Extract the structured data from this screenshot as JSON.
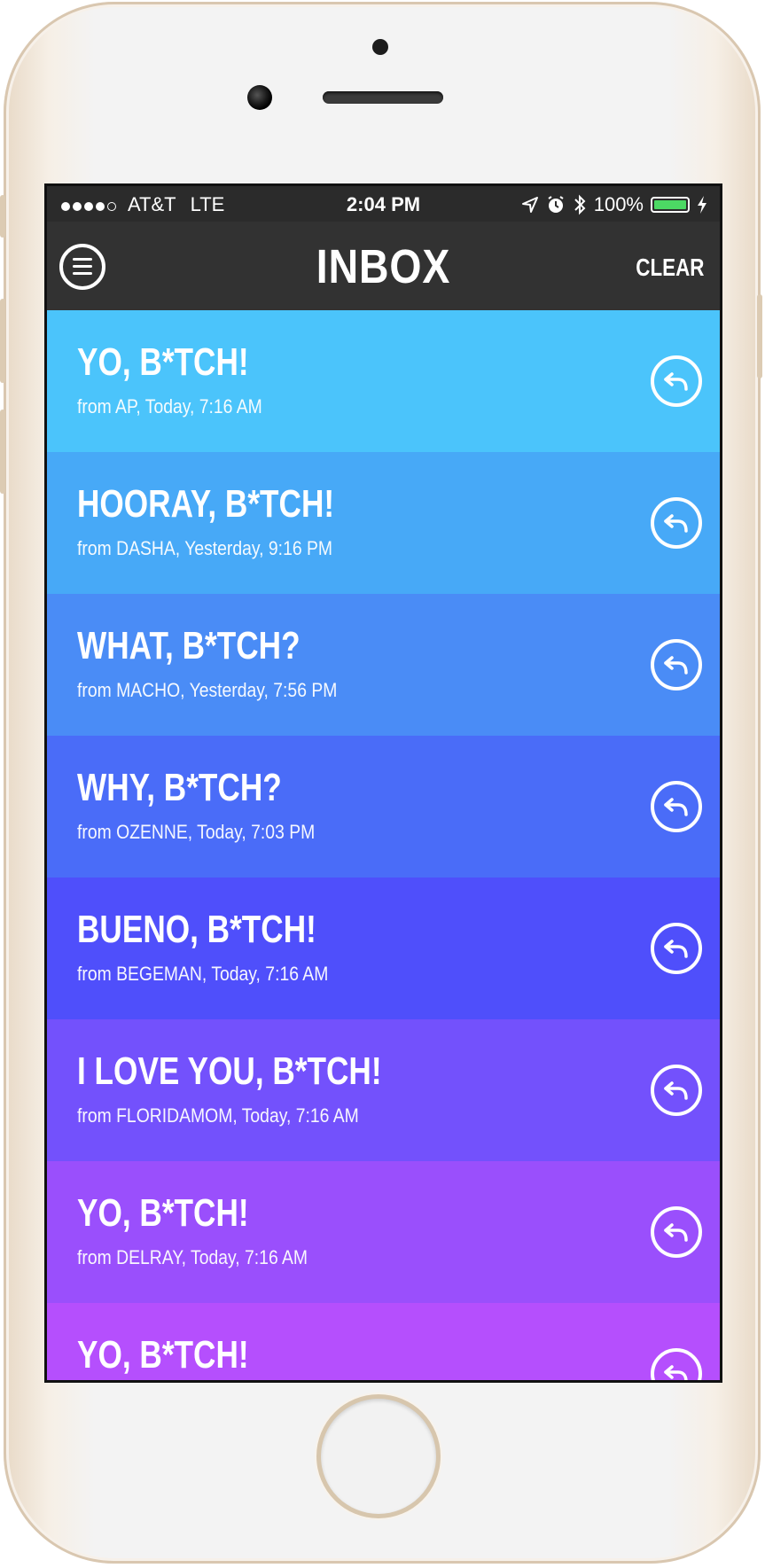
{
  "status_bar": {
    "carrier": "AT&T",
    "network": "LTE",
    "time": "2:04 PM",
    "battery": "100%",
    "battery_level": 1.0,
    "icons": [
      "location-arrow-icon",
      "alarm-icon",
      "bluetooth-icon",
      "battery-icon",
      "charging-bolt-icon"
    ]
  },
  "nav": {
    "title": "INBOX",
    "clear_label": "CLEAR",
    "menu_icon": "hamburger-menu-icon"
  },
  "messages": [
    {
      "text": "YO, B*TCH!",
      "meta": "from AP, Today, 7:16 AM",
      "color": "#4bc4fb"
    },
    {
      "text": "HOORAY, B*TCH!",
      "meta": "from DASHA, Yesterday, 9:16 PM",
      "color": "#47a9f7"
    },
    {
      "text": "WHAT, B*TCH?",
      "meta": "from MACHO, Yesterday, 7:56 PM",
      "color": "#4a8cf6"
    },
    {
      "text": "WHY, B*TCH?",
      "meta": "from OZENNE, Today, 7:03 PM",
      "color": "#4a6cf8"
    },
    {
      "text": "BUENO, B*TCH!",
      "meta": "from BEGEMAN, Today, 7:16 AM",
      "color": "#4f4ffb"
    },
    {
      "text": "I LOVE YOU, B*TCH!",
      "meta": "from FLORIDAMOM, Today, 7:16 AM",
      "color": "#7351fc"
    },
    {
      "text": "YO, B*TCH!",
      "meta": "from DELRAY, Today, 7:16 AM",
      "color": "#9a4ffc"
    },
    {
      "text": "YO, B*TCH!",
      "meta": "",
      "color": "#b54ffd"
    }
  ]
}
